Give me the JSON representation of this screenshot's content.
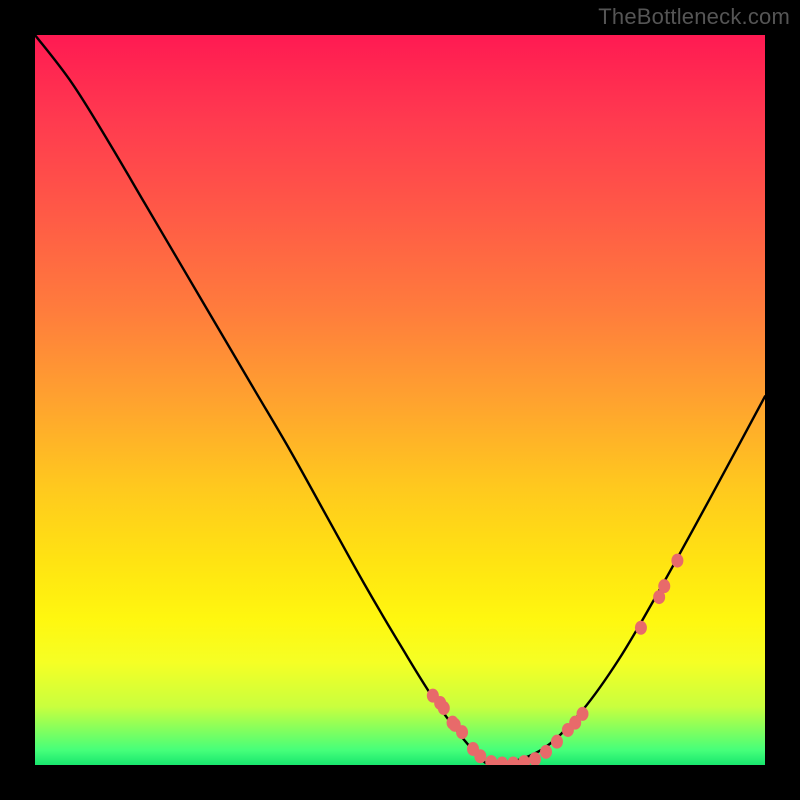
{
  "watermark": "TheBottleneck.com",
  "chart_data": {
    "type": "line",
    "title": "",
    "xlabel": "",
    "ylabel": "",
    "xlim": [
      0,
      100
    ],
    "ylim": [
      0,
      100
    ],
    "series": [
      {
        "name": "curve",
        "x_norm": [
          0.0,
          0.05,
          0.1,
          0.15,
          0.2,
          0.25,
          0.3,
          0.35,
          0.4,
          0.45,
          0.5,
          0.55,
          0.6,
          0.624,
          0.65,
          0.7,
          0.75,
          0.8,
          0.85,
          0.9,
          0.95,
          1.0
        ],
        "y_norm": [
          1.0,
          0.935,
          0.855,
          0.77,
          0.685,
          0.6,
          0.515,
          0.43,
          0.34,
          0.25,
          0.165,
          0.085,
          0.02,
          0.0,
          0.003,
          0.025,
          0.075,
          0.145,
          0.23,
          0.32,
          0.412,
          0.505
        ]
      }
    ],
    "markers": {
      "name": "scatter-points",
      "color": "#e86a6a",
      "x_norm": [
        0.545,
        0.555,
        0.56,
        0.572,
        0.575,
        0.585,
        0.6,
        0.61,
        0.625,
        0.64,
        0.655,
        0.67,
        0.685,
        0.7,
        0.715,
        0.73,
        0.74,
        0.75,
        0.83,
        0.855,
        0.862,
        0.88
      ],
      "y_norm": [
        0.095,
        0.085,
        0.078,
        0.058,
        0.055,
        0.045,
        0.022,
        0.012,
        0.004,
        0.002,
        0.002,
        0.004,
        0.008,
        0.018,
        0.032,
        0.048,
        0.058,
        0.07,
        0.188,
        0.23,
        0.245,
        0.28
      ]
    },
    "notes": "Axes and precise numeric values are not labeled in the source image; x_norm and y_norm are normalized [0..1] coordinates within the plot rectangle (origin at bottom-left). Curve depicts a steep descent from upper-left to a flat trough near x≈0.62 then a rise toward the right edge reaching roughly half-height."
  }
}
